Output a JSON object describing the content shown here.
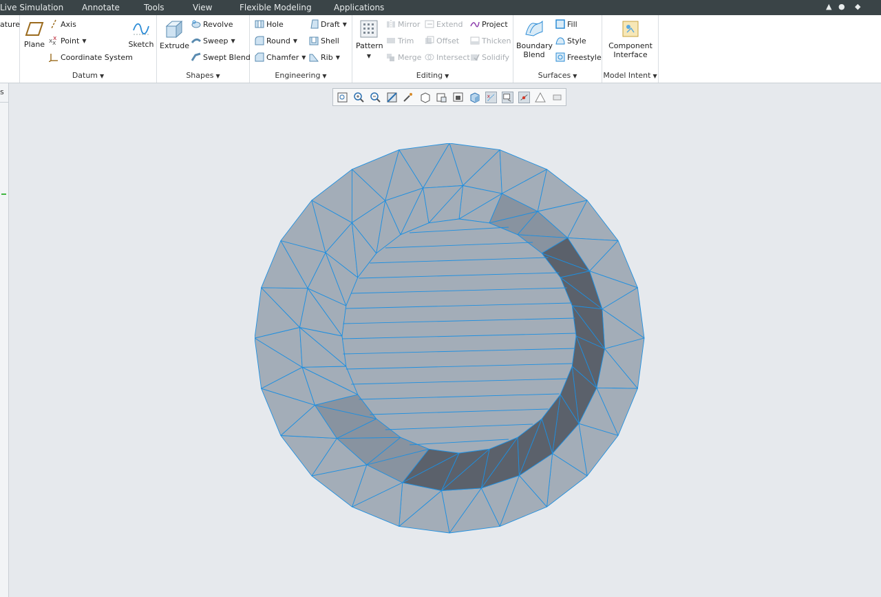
{
  "menu": {
    "items": [
      "Live Simulation",
      "Annotate",
      "Tools",
      "View",
      "Flexible Modeling",
      "Applications"
    ]
  },
  "ribbon": {
    "partial_left": "ature",
    "datum": {
      "label": "Datum",
      "plane": "Plane",
      "axis": "Axis",
      "point": "Point",
      "coordinate_system": "Coordinate System",
      "sketch": "Sketch"
    },
    "shapes": {
      "label": "Shapes",
      "extrude": "Extrude",
      "revolve": "Revolve",
      "sweep": "Sweep",
      "swept_blend": "Swept Blend"
    },
    "engineering": {
      "label": "Engineering",
      "hole": "Hole",
      "round": "Round",
      "chamfer": "Chamfer",
      "draft": "Draft",
      "shell": "Shell",
      "rib": "Rib"
    },
    "editing": {
      "label": "Editing",
      "pattern": "Pattern",
      "mirror": "Mirror",
      "trim": "Trim",
      "merge": "Merge",
      "extend": "Extend",
      "offset": "Offset",
      "intersect": "Intersect",
      "project": "Project",
      "thicken": "Thicken",
      "solidify": "Solidify"
    },
    "surfaces": {
      "label": "Surfaces",
      "boundary_blend_1": "Boundary",
      "boundary_blend_2": "Blend",
      "fill": "Fill",
      "style": "Style",
      "freestyle": "Freestyle"
    },
    "model_intent": {
      "label": "Model Intent",
      "component_interface_1": "Component",
      "component_interface_2": "Interface"
    }
  },
  "left_panel": {
    "partial_tab": "s"
  },
  "colors": {
    "menubar": "#3a4447",
    "viewport": "#e6e9ed",
    "mesh_edge": "#1e8fe0",
    "face_light": "#a3adb8",
    "face_mid": "#8893a0",
    "face_dark": "#5b616b"
  }
}
